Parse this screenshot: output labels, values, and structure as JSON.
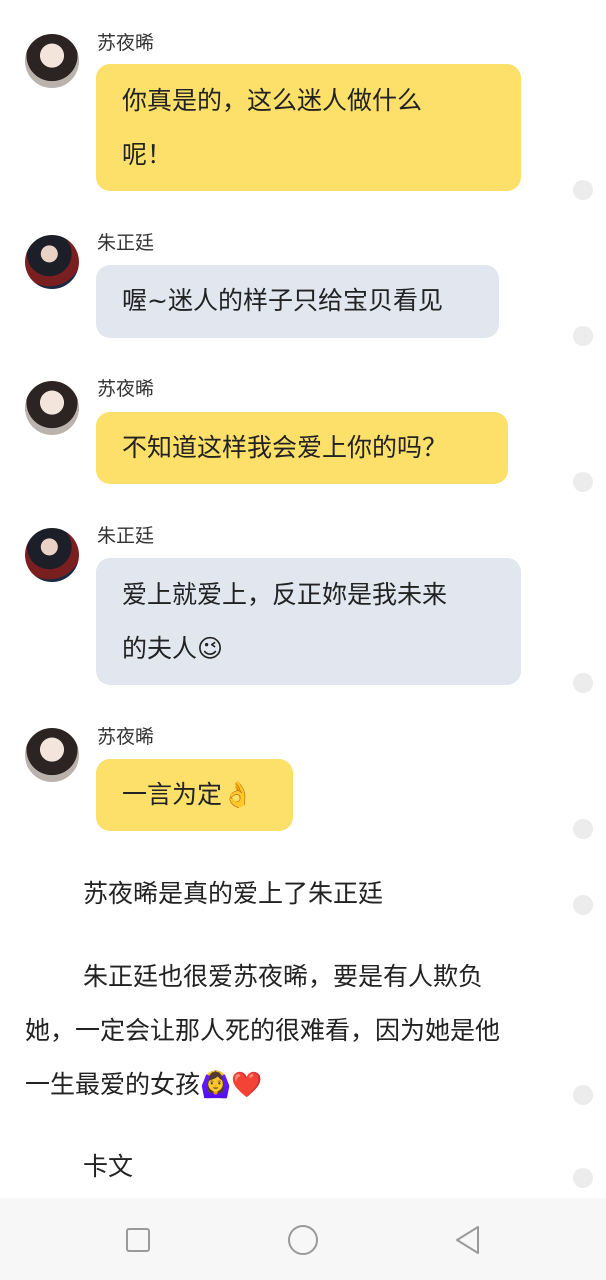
{
  "messages": [
    {
      "sender": "苏夜晞",
      "text": "你真是的，这么迷人做什么呢！",
      "line1": "你真是的，这么迷人做什么",
      "line2": "呢！"
    },
    {
      "sender": "朱正廷",
      "text": "喔~迷人的样子只给宝贝看见"
    },
    {
      "sender": "苏夜晞",
      "text": "不知道这样我会爱上你的吗？"
    },
    {
      "sender": "朱正廷",
      "line1": "爱上就爱上，反正妳是我未来",
      "line2": "的夫人",
      "emoji": "😉"
    },
    {
      "sender": "苏夜晞",
      "text": "一言为定",
      "emoji": "👌"
    }
  ],
  "narration": {
    "p1": "苏夜晞是真的爱上了朱正廷",
    "p2_line1": "朱正廷也很爱苏夜晞，要是有人欺负",
    "p2_line2": "她，一定会让那人死的很难看，因为她是他",
    "p2_line3": "一生最爱的女孩",
    "p2_emoji": "🙆‍♀️❤️",
    "p3": "卡文"
  },
  "colors": {
    "bubble_self": "#fde069",
    "bubble_other": "#e2e6ef",
    "navbar_bg": "#f7f7f7"
  },
  "navbar": {
    "icons": [
      "recent-apps-icon",
      "home-icon",
      "back-icon"
    ]
  }
}
